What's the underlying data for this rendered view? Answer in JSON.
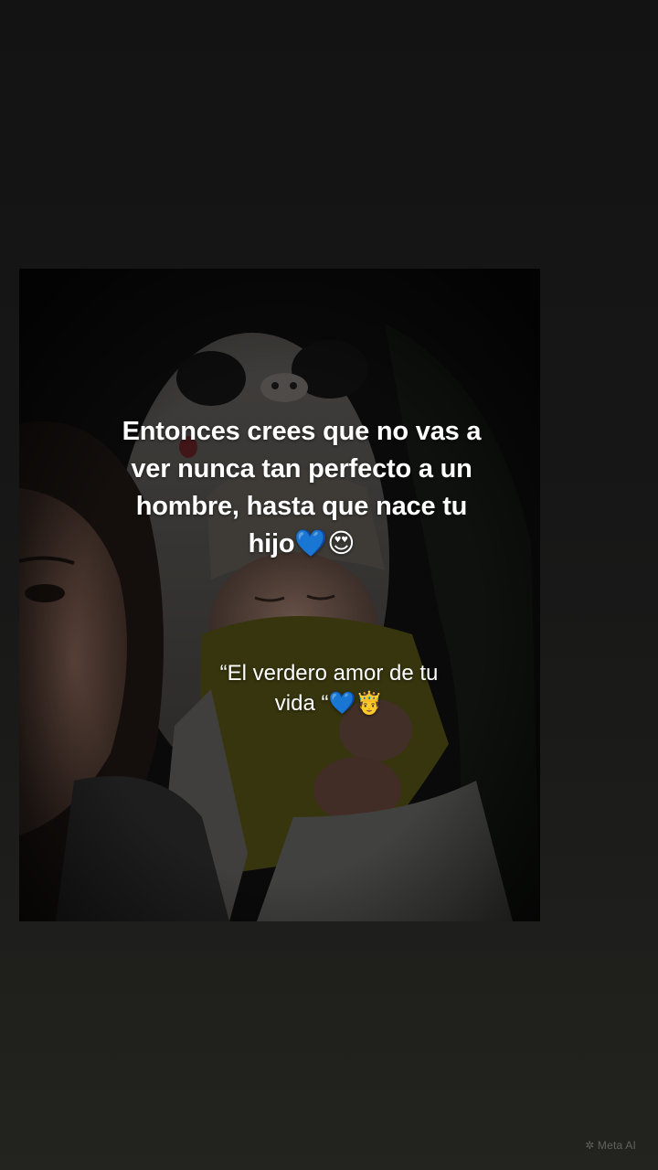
{
  "caption": {
    "main_line1": "Entonces  crees que no vas a",
    "main_line2": "ver nunca tan perfecto a un",
    "main_line3": "hombre, hasta que nace tu",
    "main_line4": "hijo💙😍",
    "sub_line1": "“El verdero amor de tu",
    "sub_line2": "vida “💙🤴"
  },
  "watermark": {
    "label": "Meta AI"
  }
}
